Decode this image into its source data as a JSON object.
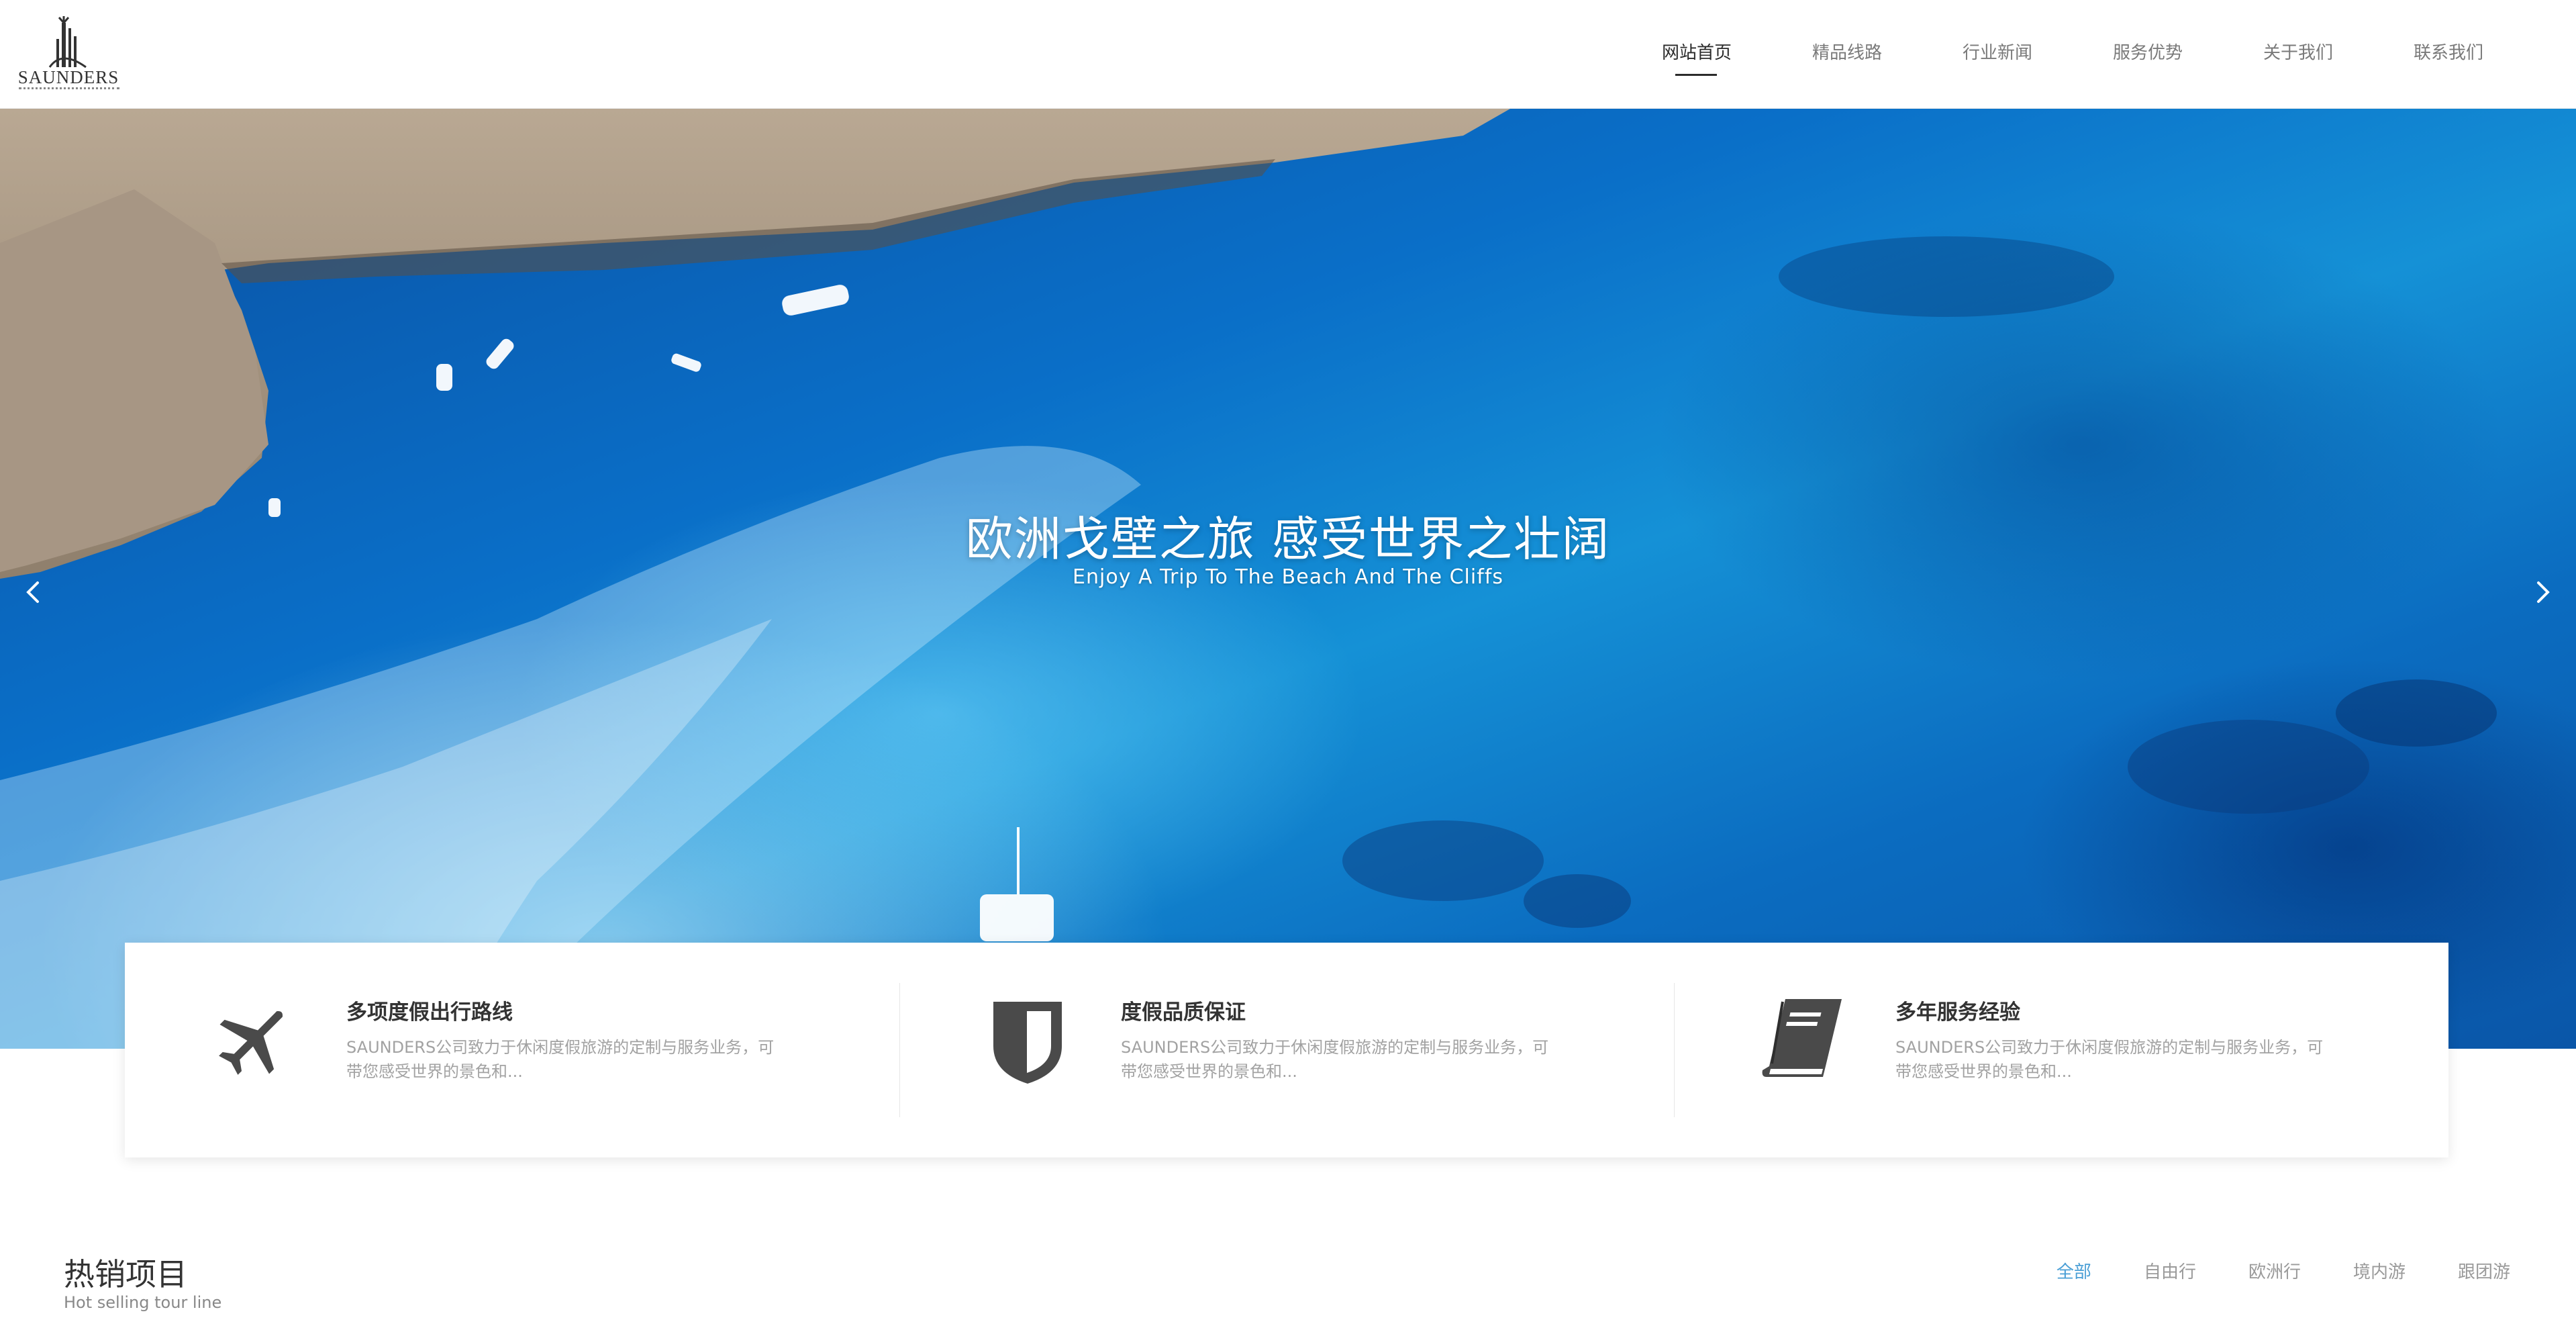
{
  "header": {
    "logo_text": "SAUNDERS",
    "nav": [
      {
        "label": "网站首页",
        "active": true
      },
      {
        "label": "精品线路",
        "active": false
      },
      {
        "label": "行业新闻",
        "active": false
      },
      {
        "label": "服务优势",
        "active": false
      },
      {
        "label": "关于我们",
        "active": false
      },
      {
        "label": "联系我们",
        "active": false
      }
    ]
  },
  "hero": {
    "title": "欧洲戈壁之旅 感受世界之壮阔",
    "subtitle": "Enjoy A Trip To The Beach And The Cliffs",
    "prev_icon": "chevron-left-icon",
    "next_icon": "chevron-right-icon"
  },
  "features": [
    {
      "icon": "airplane-icon",
      "title": "多项度假出行路线",
      "desc_line1": "SAUNDERS公司致力于休闲度假旅游的定制与服务业务，可",
      "desc_line2": "带您感受世界的景色和..."
    },
    {
      "icon": "shield-icon",
      "title": "度假品质保证",
      "desc_line1": "SAUNDERS公司致力于休闲度假旅游的定制与服务业务，可",
      "desc_line2": "带您感受世界的景色和..."
    },
    {
      "icon": "book-icon",
      "title": "多年服务经验",
      "desc_line1": "SAUNDERS公司致力于休闲度假旅游的定制与服务业务，可",
      "desc_line2": "带您感受世界的景色和..."
    }
  ],
  "hot_selling": {
    "title": "热销项目",
    "subtitle": "Hot selling tour line",
    "filters": [
      {
        "label": "全部",
        "active": true
      },
      {
        "label": "自由行",
        "active": false
      },
      {
        "label": "欧洲行",
        "active": false
      },
      {
        "label": "境内游",
        "active": false
      },
      {
        "label": "跟团游",
        "active": false
      }
    ]
  },
  "colors": {
    "accent": "#4a9fd6",
    "nav_active": "#2b2b2b",
    "icon_gray": "#4a4a4a"
  }
}
